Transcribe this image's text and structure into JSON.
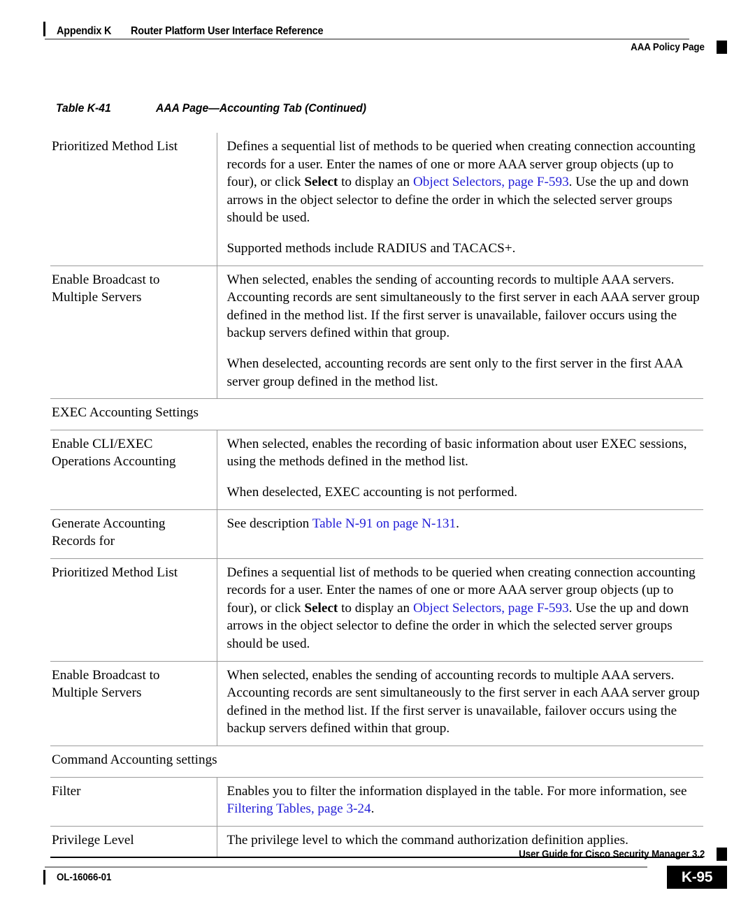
{
  "header": {
    "appendix": "Appendix K",
    "title": "Router Platform User Interface Reference",
    "policy_page": "AAA Policy Page"
  },
  "caption": {
    "number": "Table K-41",
    "title": "AAA Page—Accounting Tab (Continued)"
  },
  "colors": {
    "link": "#2420d8",
    "rule": "#9a9a9a",
    "text": "#000000"
  },
  "table": {
    "rows": [
      {
        "type": "data",
        "label": "Prioritized Method List",
        "paragraphs": [
          {
            "runs": [
              {
                "text": "Defines a sequential list of methods to be queried when creating connection accounting records for a user. Enter the names of one or more AAA server group objects (up to four), or click ",
                "style": "normal"
              },
              {
                "text": "Select",
                "style": "bold"
              },
              {
                "text": " to display an ",
                "style": "normal"
              },
              {
                "text": "Object Selectors, page F-593",
                "style": "link"
              },
              {
                "text": ". Use the up and down arrows in the object selector to define the order in which the selected server groups should be used.",
                "style": "normal"
              }
            ]
          },
          {
            "runs": [
              {
                "text": "Supported methods include RADIUS and TACACS+.",
                "style": "normal"
              }
            ]
          }
        ]
      },
      {
        "type": "data",
        "label": "Enable Broadcast to Multiple Servers",
        "paragraphs": [
          {
            "runs": [
              {
                "text": "When selected, enables the sending of accounting records to multiple AAA servers. Accounting records are sent simultaneously to the first server in each AAA server group defined in the method list. If the first server is unavailable, failover occurs using the backup servers defined within that group.",
                "style": "normal"
              }
            ]
          },
          {
            "runs": [
              {
                "text": "When deselected, accounting records are sent only to the first server in the first AAA server group defined in the method list.",
                "style": "normal"
              }
            ]
          }
        ]
      },
      {
        "type": "section",
        "label": "EXEC Accounting Settings"
      },
      {
        "type": "data",
        "label": "Enable CLI/EXEC Operations Accounting",
        "paragraphs": [
          {
            "runs": [
              {
                "text": "When selected, enables the recording of basic information about user EXEC sessions, using the methods defined in the method list.",
                "style": "normal"
              }
            ]
          },
          {
            "runs": [
              {
                "text": "When deselected, EXEC accounting is not performed.",
                "style": "normal"
              }
            ]
          }
        ]
      },
      {
        "type": "data",
        "label": "Generate Accounting Records for",
        "paragraphs": [
          {
            "runs": [
              {
                "text": "See description ",
                "style": "normal"
              },
              {
                "text": "Table N-91 on page N-131",
                "style": "link"
              },
              {
                "text": ".",
                "style": "normal"
              }
            ]
          }
        ]
      },
      {
        "type": "data",
        "label": "Prioritized Method List",
        "paragraphs": [
          {
            "runs": [
              {
                "text": "Defines a sequential list of methods to be queried when creating connection accounting records for a user. Enter the names of one or more AAA server group objects (up to four), or click ",
                "style": "normal"
              },
              {
                "text": "Select",
                "style": "bold"
              },
              {
                "text": " to display an ",
                "style": "normal"
              },
              {
                "text": "Object Selectors, page F-593",
                "style": "link"
              },
              {
                "text": ". Use the up and down arrows in the object selector to define the order in which the selected server groups should be used.",
                "style": "normal"
              }
            ]
          }
        ]
      },
      {
        "type": "data",
        "label": "Enable Broadcast to Multiple Servers",
        "paragraphs": [
          {
            "runs": [
              {
                "text": "When selected, enables the sending of accounting records to multiple AAA servers. Accounting records are sent simultaneously to the first server in each AAA server group defined in the method list. If the first server is unavailable, failover occurs using the backup servers defined within that group.",
                "style": "normal"
              }
            ]
          }
        ]
      },
      {
        "type": "section",
        "label": "Command Accounting settings"
      },
      {
        "type": "data",
        "label": "Filter",
        "paragraphs": [
          {
            "runs": [
              {
                "text": "Enables you to filter the information displayed in the table. For more information, see ",
                "style": "normal"
              },
              {
                "text": "Filtering Tables, page 3-24",
                "style": "link"
              },
              {
                "text": ".",
                "style": "normal"
              }
            ]
          }
        ]
      },
      {
        "type": "data",
        "label": "Privilege Level",
        "paragraphs": [
          {
            "runs": [
              {
                "text": "The privilege level to which the command authorization definition applies.",
                "style": "normal"
              }
            ]
          }
        ]
      }
    ]
  },
  "footer": {
    "doc_id": "OL-16066-01",
    "guide": "User Guide for Cisco Security Manager 3.2",
    "page_number": "K-95"
  }
}
